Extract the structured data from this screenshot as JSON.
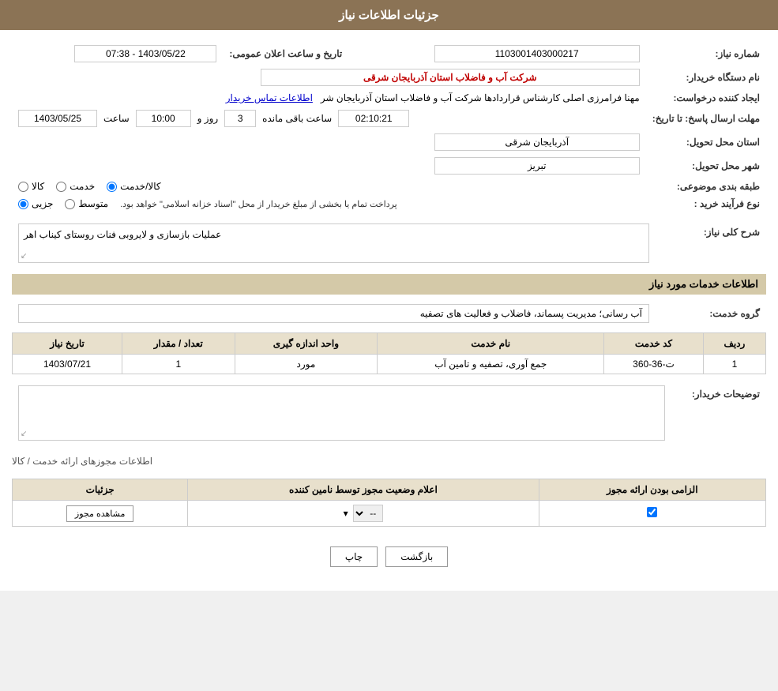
{
  "page": {
    "header": "جزئیات اطلاعات نیاز",
    "sections": {
      "main_info": {
        "fields": {
          "tender_number_label": "شماره نیاز:",
          "tender_number_value": "1103001403000217",
          "buyer_org_label": "نام دستگاه خریدار:",
          "buyer_org_value": "شرکت آب و فاضلاب استان آذربایجان شرقی",
          "requester_label": "ایجاد کننده درخواست:",
          "requester_value": "مهنا فرامرزی اصلی کارشناس قراردادها شرکت آب و فاضلاب استان آذربایجان شر",
          "requester_link": "اطلاعات تماس خریدار",
          "deadline_label": "مهلت ارسال پاسخ: تا تاریخ:",
          "deadline_date": "1403/05/25",
          "deadline_time_label": "ساعت",
          "deadline_time": "10:00",
          "deadline_days_label": "روز و",
          "deadline_days": "3",
          "deadline_remaining_label": "ساعت باقی مانده",
          "deadline_remaining": "02:10:21",
          "announce_date_label": "تاریخ و ساعت اعلان عمومی:",
          "announce_date_value": "1403/05/22 - 07:38",
          "province_label": "استان محل تحویل:",
          "province_value": "آذربایجان شرقی",
          "city_label": "شهر محل تحویل:",
          "city_value": "تبریز",
          "category_label": "طبقه بندی موضوعی:",
          "category_options": [
            {
              "value": "kala",
              "label": "کالا",
              "selected": false
            },
            {
              "value": "khadamat",
              "label": "خدمت",
              "selected": false
            },
            {
              "value": "kala_khadamat",
              "label": "کالا/خدمت",
              "selected": true
            }
          ],
          "purchase_type_label": "نوع فرآیند خرید :",
          "purchase_type_options": [
            {
              "value": "jozvi",
              "label": "جزیی",
              "selected": true
            },
            {
              "value": "motavasset",
              "label": "متوسط",
              "selected": false
            }
          ],
          "purchase_type_note": "پرداخت تمام یا بخشی از مبلغ خریدار از محل \"اسناد خزانه اسلامی\" خواهد بود."
        }
      },
      "general_description": {
        "label": "شرح کلی نیاز:",
        "value": "عملیات بازسازی و لایروبی فنات روستای کیناب اهر"
      },
      "services_info": {
        "header": "اطلاعات خدمات مورد نیاز",
        "service_group_label": "گروه خدمت:",
        "service_group_value": "آب رسانی؛ مدیریت پسماند، فاضلاب و فعالیت های تصفیه",
        "table": {
          "columns": [
            "ردیف",
            "کد خدمت",
            "نام خدمت",
            "واحد اندازه گیری",
            "تعداد / مقدار",
            "تاریخ نیاز"
          ],
          "rows": [
            {
              "row": "1",
              "service_code": "ت-36-360",
              "service_name": "جمع آوری، تصفیه و تامین آب",
              "unit": "مورد",
              "quantity": "1",
              "date": "1403/07/21"
            }
          ]
        }
      },
      "buyer_notes": {
        "label": "توضیحات خریدار:",
        "value": ""
      },
      "permits_info": {
        "header": "اطلاعات مجوزهای ارائه خدمت / کالا",
        "table": {
          "columns": [
            "الزامی بودن ارائه مجوز",
            "اعلام وضعیت مجوز توسط نامین کننده",
            "جزئیات"
          ],
          "rows": [
            {
              "required": true,
              "status": "--",
              "details_btn": "مشاهده مجوز"
            }
          ]
        }
      }
    },
    "buttons": {
      "print": "چاپ",
      "back": "بازگشت"
    }
  }
}
